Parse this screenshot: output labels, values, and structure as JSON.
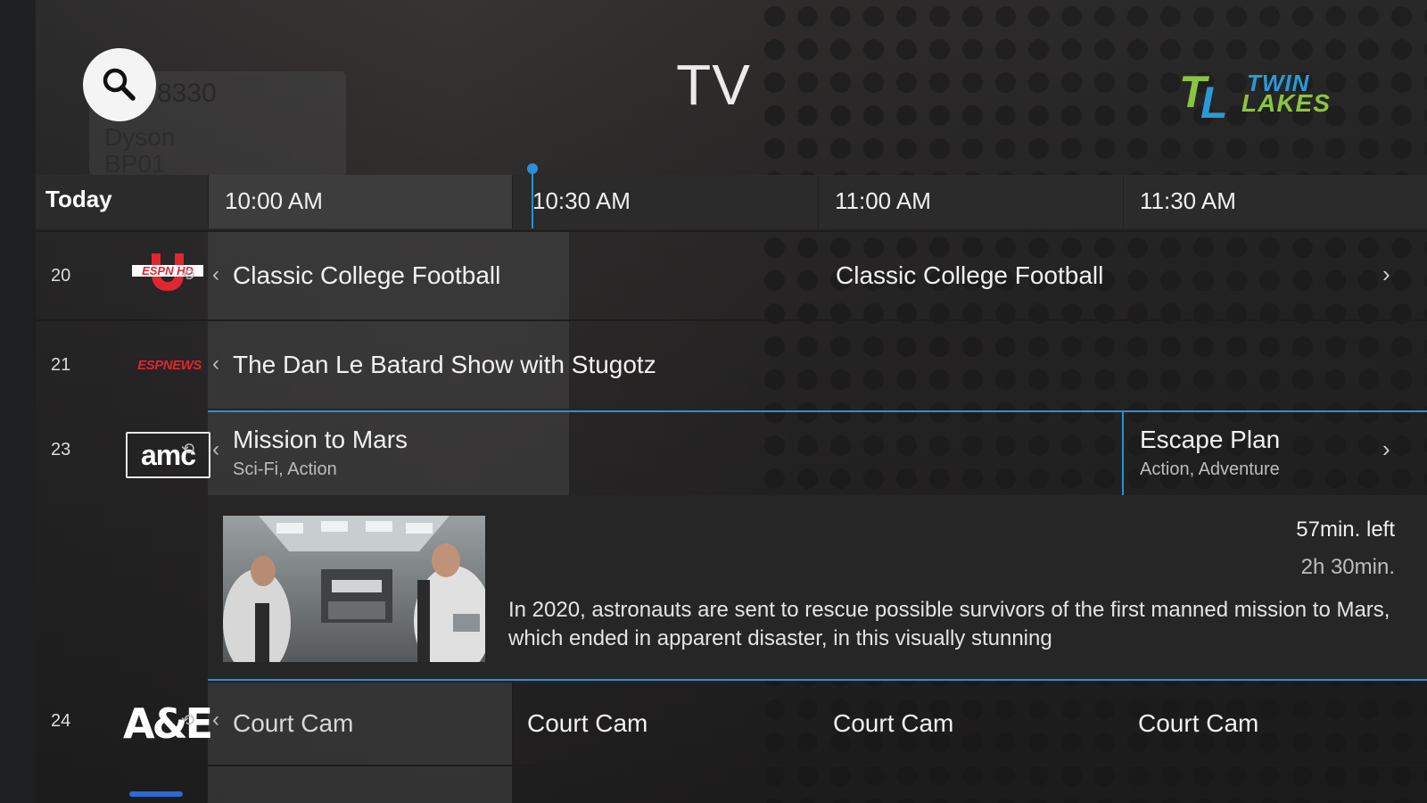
{
  "page": {
    "title": "TV"
  },
  "search": {
    "icon": "search-icon"
  },
  "background_ghost": {
    "code": "8330",
    "line1": "Dyson",
    "line2": "BP01"
  },
  "logo": {
    "line1": "TWIN",
    "line2": "LAKES",
    "mark": "TL"
  },
  "timeline": {
    "day_label": "Today",
    "slots": [
      "10:00 AM",
      "10:30 AM",
      "11:00 AM",
      "11:30 AM"
    ]
  },
  "channels": [
    {
      "number": "20",
      "logo_text": "ESPN HD",
      "programs": [
        {
          "title": "Classic College Football"
        },
        {
          "title": "Classic College Football"
        }
      ]
    },
    {
      "number": "21",
      "logo_text": "ESPNEWS",
      "programs": [
        {
          "title": "The Dan Le Batard Show with Stugotz"
        }
      ]
    },
    {
      "number": "23",
      "logo_text": "amc",
      "programs": [
        {
          "title": "Mission to Mars",
          "genre": "Sci-Fi, Action"
        },
        {
          "title": "Escape Plan",
          "genre": "Action, Adventure"
        }
      ]
    },
    {
      "number": "24",
      "logo_text": "A&E",
      "programs": [
        {
          "title": "Court Cam"
        },
        {
          "title": "Court Cam"
        },
        {
          "title": "Court Cam"
        },
        {
          "title": "Court Cam"
        }
      ]
    }
  ],
  "detail": {
    "time_left": "57min. left",
    "duration": "2h 30min.",
    "description": "In 2020, astronauts are sent to rescue possible survivors of the first manned mission to Mars, which ended in apparent disaster, in this visually stunning"
  },
  "colors": {
    "accent": "#2e8fd6",
    "espn_red": "#e0262f",
    "logo_green": "#8bc53f",
    "logo_blue": "#2a9ad6"
  }
}
